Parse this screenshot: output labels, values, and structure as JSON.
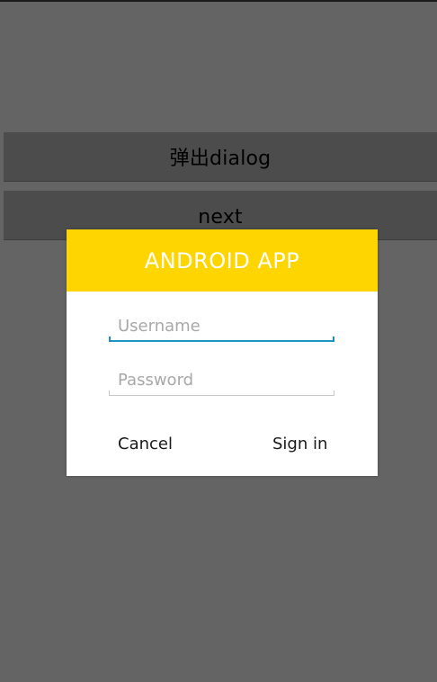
{
  "screen": {
    "popup_button_label": "弹出dialog",
    "next_button_label": "next"
  },
  "dialog": {
    "title": "ANDROID APP",
    "username": {
      "placeholder": "Username",
      "value": ""
    },
    "password": {
      "placeholder": "Password",
      "value": ""
    },
    "cancel_label": "Cancel",
    "signin_label": "Sign in"
  },
  "colors": {
    "background": "#646464",
    "app_button": "#4c4c4c",
    "dialog_header": "#ffd500",
    "focus_underline": "#1e96c4"
  }
}
